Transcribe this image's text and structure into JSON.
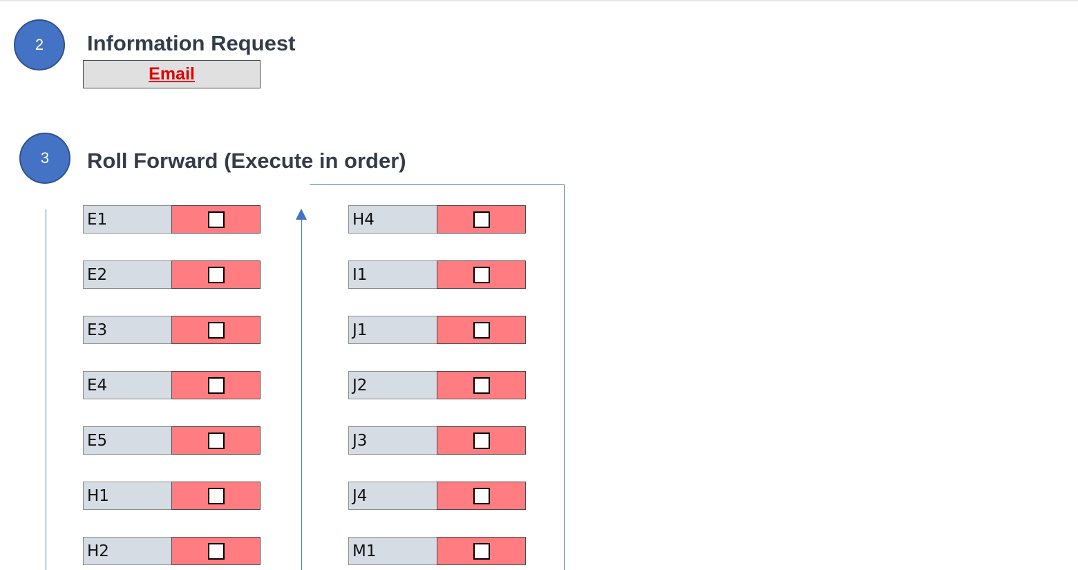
{
  "step2": {
    "number": "2",
    "title": "Information Request",
    "email_label": "Email"
  },
  "step3": {
    "number": "3",
    "title": "Roll Forward (Execute in order)",
    "left_items": [
      {
        "label": "E1",
        "checked": false
      },
      {
        "label": "E2",
        "checked": false
      },
      {
        "label": "E3",
        "checked": false
      },
      {
        "label": "E4",
        "checked": false
      },
      {
        "label": "E5",
        "checked": false
      },
      {
        "label": "H1",
        "checked": false
      },
      {
        "label": "H2",
        "checked": false
      }
    ],
    "right_items": [
      {
        "label": "H4",
        "checked": false
      },
      {
        "label": "I1",
        "checked": false
      },
      {
        "label": "J1",
        "checked": false
      },
      {
        "label": "J2",
        "checked": false
      },
      {
        "label": "J3",
        "checked": false
      },
      {
        "label": "J4",
        "checked": false
      },
      {
        "label": "M1",
        "checked": false
      }
    ]
  },
  "colors": {
    "circle": "#4472c4",
    "label_cell": "#d6dce4",
    "status_cell": "#ff7c80",
    "email_text": "#e00000",
    "connector": "#4a78b0"
  }
}
